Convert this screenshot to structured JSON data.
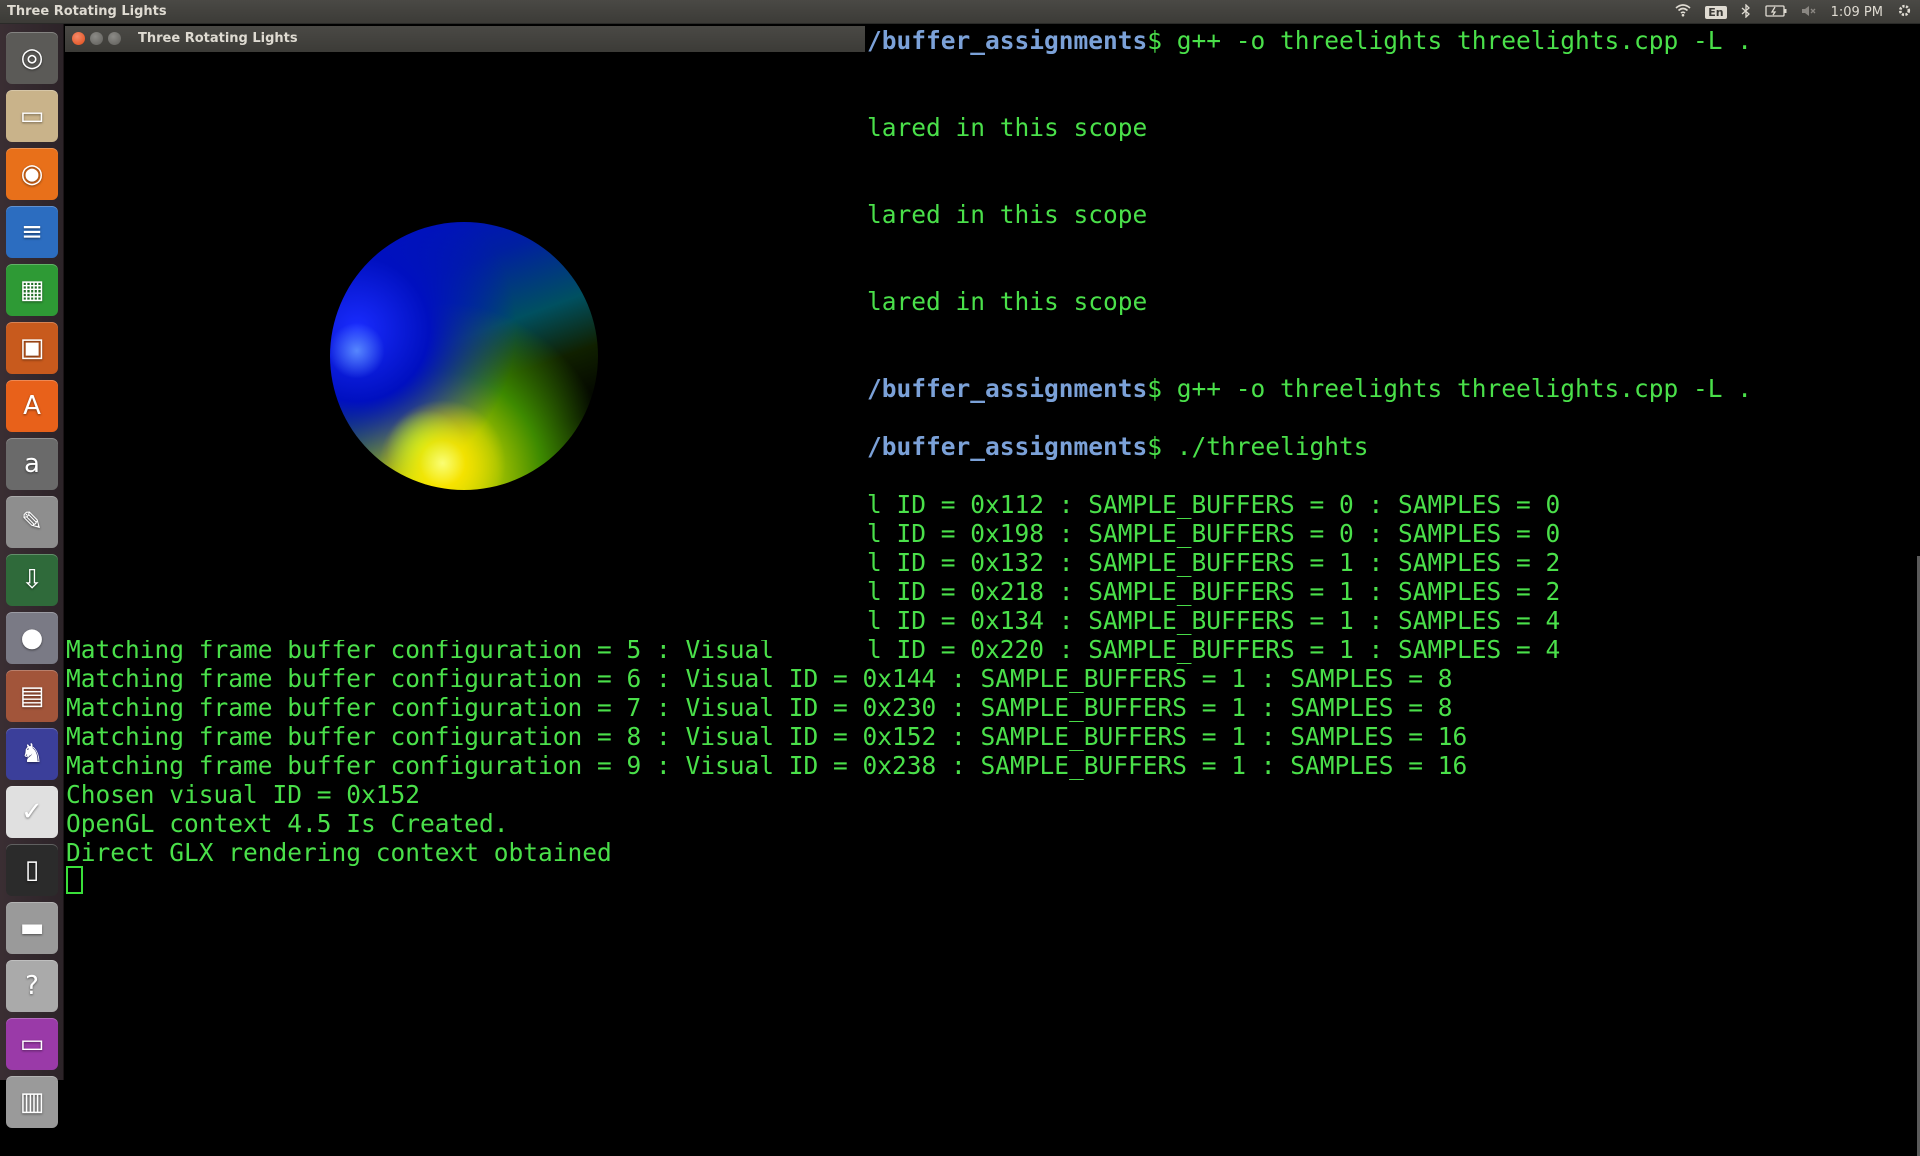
{
  "top_panel": {
    "title": "Three Rotating Lights",
    "lang": "En",
    "clock": "1:09 PM"
  },
  "icons": {
    "wifi": "wifi-icon",
    "bluetooth": "bluetooth-icon",
    "battery": "battery-icon",
    "volume": "volume-muted-icon",
    "settings": "gear-icon"
  },
  "launcher": [
    {
      "name": "dash-home",
      "glyph": "◎",
      "color": "#5b5a57"
    },
    {
      "name": "files",
      "glyph": "▭",
      "color": "#c9b38a"
    },
    {
      "name": "firefox",
      "glyph": "◉",
      "color": "#e8701a"
    },
    {
      "name": "libreoffice-writer",
      "glyph": "≡",
      "color": "#2c6dc0"
    },
    {
      "name": "libreoffice-calc",
      "glyph": "▦",
      "color": "#2e9a35"
    },
    {
      "name": "libreoffice-impress",
      "glyph": "▣",
      "color": "#c85a1d"
    },
    {
      "name": "software-center",
      "glyph": "A",
      "color": "#e8611a"
    },
    {
      "name": "amazon",
      "glyph": "a",
      "color": "#6a6a6a"
    },
    {
      "name": "system-settings",
      "glyph": "✎",
      "color": "#8e8e8e"
    },
    {
      "name": "installer",
      "glyph": "⇩",
      "color": "#2f6a3a"
    },
    {
      "name": "sphere-app",
      "glyph": "●",
      "color": "#7a7a85"
    },
    {
      "name": "archive",
      "glyph": "▤",
      "color": "#a2553a"
    },
    {
      "name": "chess",
      "glyph": "♞",
      "color": "#3b3f9a"
    },
    {
      "name": "numbers",
      "glyph": "✓",
      "color": "#e0e0e0"
    },
    {
      "name": "terminal",
      "glyph": "▯",
      "color": "#2b2b2b"
    },
    {
      "name": "scanner",
      "glyph": "▬",
      "color": "#9a9a9a"
    },
    {
      "name": "help",
      "glyph": "?",
      "color": "#aaaaaa"
    },
    {
      "name": "drive",
      "glyph": "▭",
      "color": "#9a3aa8"
    },
    {
      "name": "trash",
      "glyph": "▥",
      "color": "#9a9a9a"
    }
  ],
  "window": {
    "title": "Three Rotating Lights"
  },
  "terminal": {
    "lines_right": [
      {
        "type": "prompt",
        "path": "/buffer_assignments",
        "suffix": "$ g++ -o threelights threelights.cpp -L ."
      },
      {
        "type": "text",
        "text": "lared in this scope"
      },
      {
        "type": "text",
        "text": "lared in this scope"
      },
      {
        "type": "text",
        "text": "lared in this scope"
      },
      {
        "type": "prompt",
        "path": "/buffer_assignments",
        "suffix": "$ g++ -o threelights threelights.cpp -L ."
      },
      {
        "type": "prompt",
        "path": "/buffer_assignments",
        "suffix": "$ ./threelights"
      },
      {
        "type": "text",
        "text": "l ID = 0x112 : SAMPLE_BUFFERS = 0 : SAMPLES = 0"
      },
      {
        "type": "text",
        "text": "l ID = 0x198 : SAMPLE_BUFFERS = 0 : SAMPLES = 0"
      },
      {
        "type": "text",
        "text": "l ID = 0x132 : SAMPLE_BUFFERS = 1 : SAMPLES = 2"
      },
      {
        "type": "text",
        "text": "l ID = 0x218 : SAMPLE_BUFFERS = 1 : SAMPLES = 2"
      },
      {
        "type": "text",
        "text": "l ID = 0x134 : SAMPLE_BUFFERS = 1 : SAMPLES = 4"
      },
      {
        "type": "text",
        "text": "l ID = 0x220 : SAMPLE_BUFFERS = 1 : SAMPLES = 4"
      }
    ],
    "partial_line": "Matching frame buffer configuration = 5 : Visual",
    "lines_full": [
      "Matching frame buffer configuration = 6 : Visual ID = 0x144 : SAMPLE_BUFFERS = 1 : SAMPLES = 8",
      "Matching frame buffer configuration = 7 : Visual ID = 0x230 : SAMPLE_BUFFERS = 1 : SAMPLES = 8",
      "Matching frame buffer configuration = 8 : Visual ID = 0x152 : SAMPLE_BUFFERS = 1 : SAMPLES = 16",
      "Matching frame buffer configuration = 9 : Visual ID = 0x238 : SAMPLE_BUFFERS = 1 : SAMPLES = 16",
      "Chosen visual ID = 0x152",
      "OpenGL context 4.5 Is Created.",
      "Direct GLX rendering context obtained"
    ]
  }
}
